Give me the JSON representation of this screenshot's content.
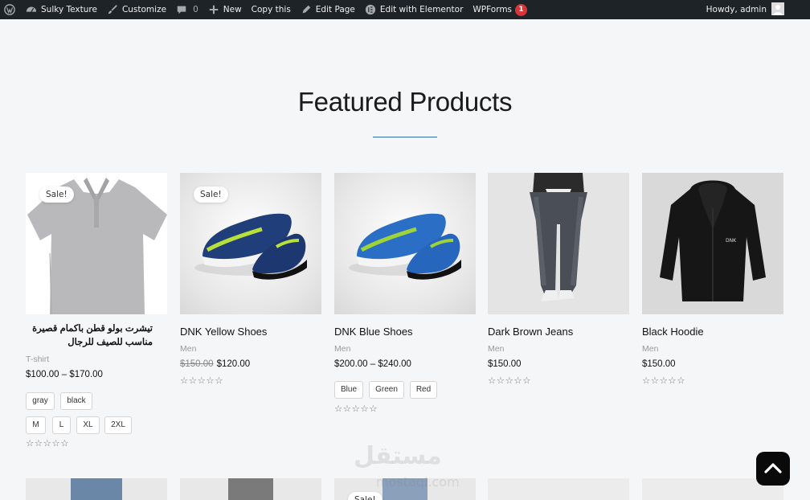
{
  "admin_bar": {
    "site_name": "Sulky Texture",
    "customize": "Customize",
    "comments_count": "0",
    "new": "New",
    "copy_this": "Copy this",
    "edit_page": "Edit Page",
    "edit_elementor": "Edit with Elementor",
    "wpforms": "WPForms",
    "wpforms_badge": "1",
    "howdy": "Howdy, admin"
  },
  "section": {
    "title": "Featured Products"
  },
  "products": [
    {
      "name": "تيشرت بولو قطن باكمام قصيرة مناسب للصيف للرجال",
      "category": "T-shirt",
      "price": "$100.00 – $170.00",
      "sale_label": "Sale!",
      "colors": [
        "gray",
        "black"
      ],
      "sizes": [
        "M",
        "L",
        "XL",
        "2XL"
      ],
      "stars": "☆☆☆☆☆"
    },
    {
      "name": "DNK Yellow Shoes",
      "category": "Men",
      "old_price": "$150.00",
      "price": "$120.00",
      "sale_label": "Sale!",
      "stars": "☆☆☆☆☆"
    },
    {
      "name": "DNK Blue Shoes",
      "category": "Men",
      "price": "$200.00 – $240.00",
      "colors": [
        "Blue",
        "Green",
        "Red"
      ],
      "stars": "☆☆☆☆☆"
    },
    {
      "name": "Dark Brown Jeans",
      "category": "Men",
      "price": "$150.00",
      "stars": "☆☆☆☆☆"
    },
    {
      "name": "Black Hoodie",
      "category": "Men",
      "price": "$150.00",
      "stars": "☆☆☆☆☆",
      "logo_text": "DNK"
    }
  ],
  "row2": {
    "sale_label": "Sale!"
  },
  "watermark": {
    "text": "مستقل",
    "sub": "mostaql.com"
  }
}
